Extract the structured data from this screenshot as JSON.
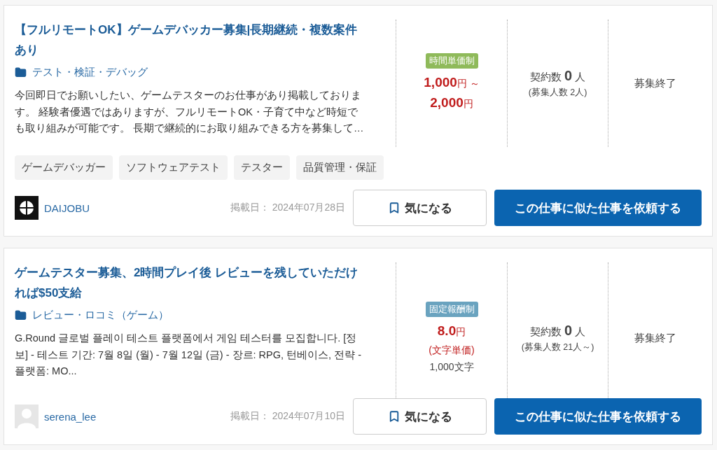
{
  "jobs": [
    {
      "title": "【フルリモートOK】ゲームデバッカー募集|長期継続・複数案件あり",
      "category": "テスト・検証・デバッグ",
      "description": "今回即日でお願いしたい、ゲームテスターのお仕事があり掲載しております。 経験者優遇ではありますが、フルリモートOK・子育て中など時短でも取り組みが可能です。 長期で継続的にお取り組みできる方を募集して…",
      "tags": [
        "ゲームデバッガー",
        "ソフトウェアテスト",
        "テスター",
        "品質管理・保証"
      ],
      "price": {
        "badge": "時間単価制",
        "color": "#8fba5a",
        "lines": [
          {
            "amount": "1,000",
            "unit": "円 ～"
          },
          {
            "amount": "2,000",
            "unit": "円"
          }
        ]
      },
      "contracts": {
        "label": "契約数",
        "count": "0",
        "unit": "人",
        "sub": "(募集人数 2人)"
      },
      "status": "募集終了",
      "client": {
        "name": "DAIJOBU",
        "kind": "logo"
      },
      "posted": "掲載日： 2024年07月28日",
      "bookmark": "気になる",
      "request": "この仕事に似た仕事を依頼する"
    },
    {
      "title": "ゲームテスター募集、2時間プレイ後 レビューを残していただければ$50支給",
      "category": "レビュー・ロコミ（ゲーム）",
      "description": "G.Round 글로벌 플레이 테스트 플랫폼에서 게임 테스터를 모집합니다. [정보] - 테스트 기간: 7월 8일 (월) - 7월 12일 (금) - 장르: RPG, 턴베이스, 전략 -플랫폼: MO...",
      "price": {
        "badge": "固定報酬制",
        "color": "#6aa3bf",
        "lines": [
          {
            "amount": "8.0",
            "unit": "円"
          }
        ],
        "note": "(文字単価)",
        "detail": "1,000文字"
      },
      "contracts": {
        "label": "契約数",
        "count": "0",
        "unit": "人",
        "sub": "(募集人数 21人～)"
      },
      "status": "募集終了",
      "client": {
        "name": "serena_lee",
        "kind": "default"
      },
      "posted": "掲載日： 2024年07月10日",
      "bookmark": "気になる",
      "request": "この仕事に似た仕事を依頼する"
    }
  ]
}
